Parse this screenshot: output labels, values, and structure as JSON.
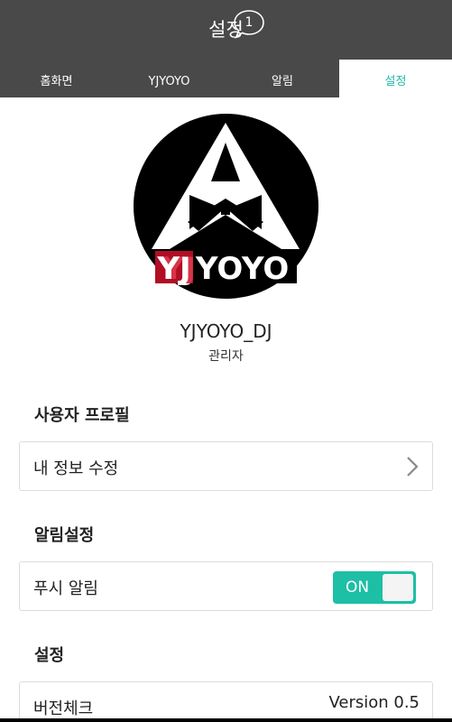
{
  "header": {
    "title": "설정",
    "notification_count": "1"
  },
  "tabs": [
    {
      "label": "홈화면",
      "active": false
    },
    {
      "label": "YJYOYO",
      "active": false
    },
    {
      "label": "알림",
      "active": false
    },
    {
      "label": "설정",
      "active": true
    }
  ],
  "profile": {
    "logo_text": "YJYOYO",
    "username": "YJYOYO_DJ",
    "role": "관리자"
  },
  "sections": {
    "user_profile": {
      "title": "사용자 프로필",
      "edit_info_label": "내 정보 수정"
    },
    "notification_settings": {
      "title": "알림설정",
      "push_label": "푸시 알림",
      "push_state": "ON"
    },
    "settings": {
      "title": "설정",
      "version_check_label": "버전체크",
      "version_value": "Version 0.5"
    }
  },
  "colors": {
    "header_bg": "#494949",
    "accent": "#1dbfa5",
    "active_tab_text": "#22b8a8",
    "logo_red": "#d0102a"
  }
}
